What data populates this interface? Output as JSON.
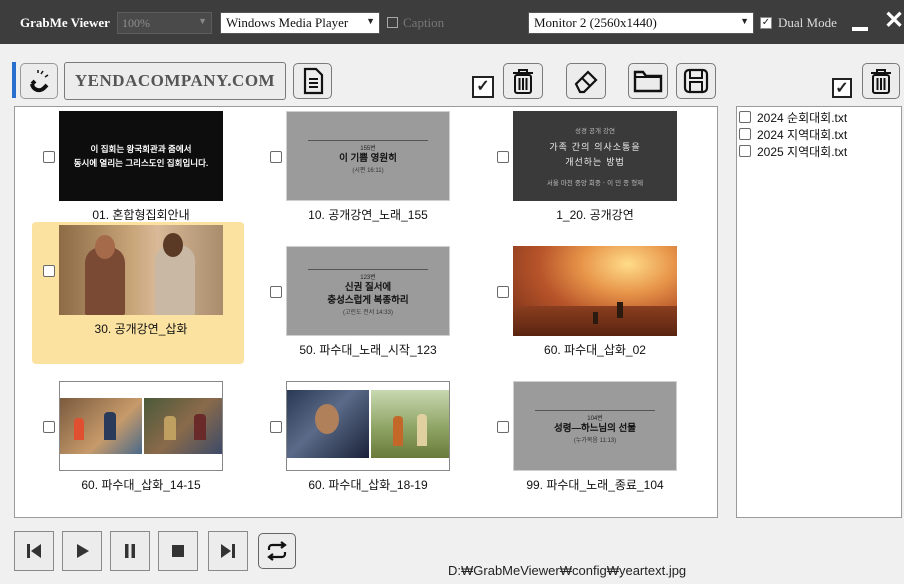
{
  "titlebar": {
    "app_title": "GrabMe Viewer",
    "zoom_value": "100%",
    "player": "Windows Media Player",
    "caption_label": "Caption",
    "caption_checked": false,
    "monitor": "Monitor 2 (2560x1440)",
    "dual_mode_label": "Dual Mode",
    "dual_mode_checked": true
  },
  "toolbar": {
    "company_name": "YENDACOMPANY.COM"
  },
  "gallery": {
    "items": [
      {
        "caption": "01. 혼합형집회안내",
        "selected": false,
        "thumb_lines": [
          "이 집회는 왕국회관과 줌에서",
          "동시에 열리는 그리스도인 집회입니다."
        ]
      },
      {
        "caption": "10. 공개강연_노래_155",
        "selected": false,
        "thumb_num": "155번",
        "thumb_title": "이 기쁨 영원히",
        "thumb_ref": "(시편 16:11)"
      },
      {
        "caption": "1_20. 공개강연",
        "selected": false,
        "thumb_top": "성경 공개 강연",
        "thumb_title1": "가족 간의 의사소통을",
        "thumb_title2": "개선하는 방법",
        "thumb_bottom": "서울 마천 중앙 회중 · 이 민 종 형제"
      },
      {
        "caption": "30. 공개강연_삽화",
        "selected": true
      },
      {
        "caption": "50. 파수대_노래_시작_123",
        "selected": false,
        "thumb_num": "123번",
        "thumb_title1": "신권 질서에",
        "thumb_title2": "충성스럽게 복종하리",
        "thumb_ref": "(고린도 전서 14:33)"
      },
      {
        "caption": "60. 파수대_삽화_02",
        "selected": false
      },
      {
        "caption": "60. 파수대_삽화_14-15",
        "selected": false
      },
      {
        "caption": "60. 파수대_삽화_18-19",
        "selected": false
      },
      {
        "caption": "99. 파수대_노래_종료_104",
        "selected": false,
        "thumb_num": "104번",
        "thumb_title": "성령—하느님의 선물",
        "thumb_ref": "(누가복음 11:13)"
      }
    ]
  },
  "side_panel": {
    "files": [
      "2024 순회대회.txt",
      "2024 지역대회.txt",
      "2025 지역대회.txt"
    ]
  },
  "footer": {
    "path": "D:₩GrabMeViewer₩config₩yeartext.jpg"
  },
  "colors": {
    "titlebar": "#3d3d3d",
    "selected_item": "#fbe2a0",
    "accent": "#2a6fce"
  }
}
